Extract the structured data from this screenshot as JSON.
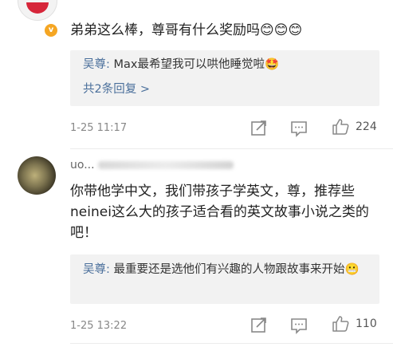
{
  "comments": [
    {
      "text": "弟弟这么棒，尊哥有什么奖励吗😊😊😊",
      "reply": {
        "author": "吴尊:",
        "text": " Max最希望我可以哄他睡觉啦🤩"
      },
      "more_replies": "共2条回复 >",
      "time": "1-25 11:17",
      "likes": "224"
    },
    {
      "username": "uo...",
      "text": "你带他学中文，我们带孩子学英文，尊，推荐些neinei这么大的孩子适合看的英文故事小说之类的吧！",
      "reply": {
        "author": "吴尊:",
        "text": " 最重要还是选他们有兴趣的人物跟故事来开始😬"
      },
      "time": "1-25 13:22",
      "likes": "110"
    }
  ]
}
